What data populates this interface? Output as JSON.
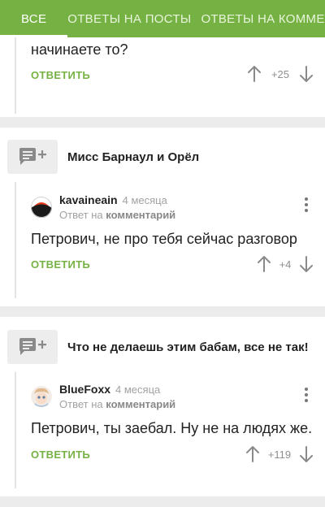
{
  "tabs": [
    {
      "label": "ВСЕ"
    },
    {
      "label": "ОТВЕТЫ НА ПОСТЫ"
    },
    {
      "label": "ОТВЕТЫ НА КОММЕНТАРИИ"
    }
  ],
  "cards": [
    {
      "comment_text": "начинаете то?",
      "reply_label": "ОТВЕТИТЬ",
      "score": "+25"
    },
    {
      "post_title": "Мисс Барнаул и Орёл",
      "author": "kavaineain",
      "time": "4 месяца",
      "reply_prefix": "Ответ на",
      "reply_target": "комментарий",
      "comment_text": "Петрович, не про тебя сейчас разговор",
      "reply_label": "ОТВЕТИТЬ",
      "score": "+4"
    },
    {
      "post_title": "Что не делаешь этим бабам, все не так!",
      "author": "BlueFoxx",
      "time": "4 месяца",
      "reply_prefix": "Ответ на",
      "reply_target": "комментарий",
      "comment_text": "Петрович, ты заебал. Ну не на людях же.",
      "reply_label": "ОТВЕТИТЬ",
      "score": "+119"
    }
  ],
  "colors": {
    "accent": "#76b243",
    "background": "#ececec",
    "text": "#222222",
    "muted": "#a2a2a2"
  },
  "icons": {
    "upvote": "arrow-up-icon",
    "downvote": "arrow-down-icon",
    "reply_to_post": "comment-add-icon",
    "menu": "more-vertical-icon"
  }
}
